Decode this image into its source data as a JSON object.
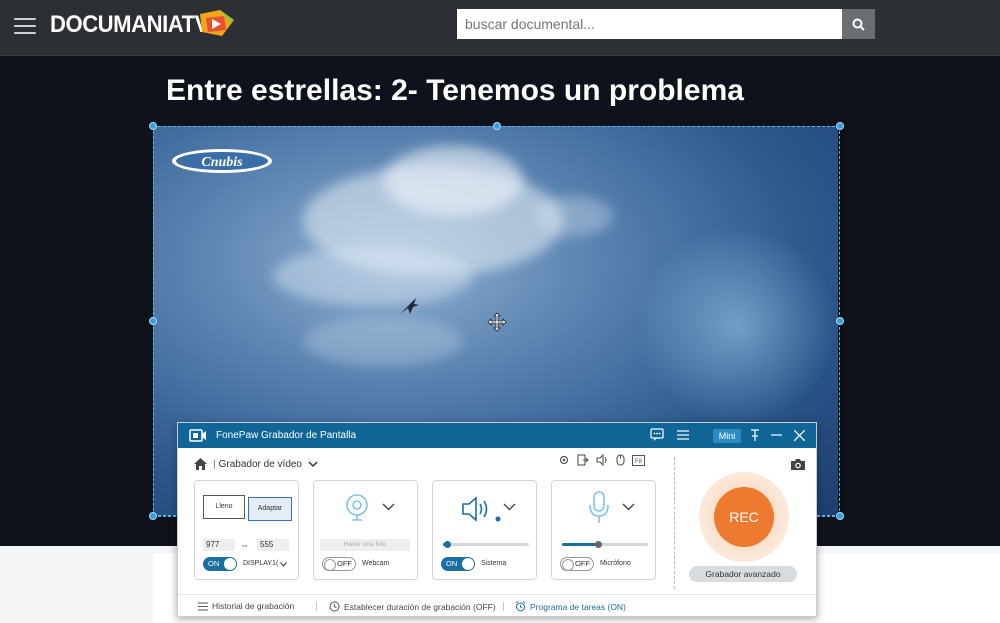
{
  "site": {
    "logo_text": "DOCUMANIATV",
    "search_placeholder": "buscar documental..."
  },
  "page": {
    "title": "Entre estrellas: 2- Tenemos un problema"
  },
  "video": {
    "channel_logo_text": "Cnubis"
  },
  "recorder": {
    "title": "FonePaw Grabador de Pantalla",
    "mini_label": "Mini",
    "mode_separator": "|",
    "mode_label": "Grabador de vídeo",
    "display": {
      "lleno_label": "Lleno",
      "adaptar_label": "Adaptar",
      "width": "977",
      "height": "555",
      "toggle": "ON",
      "source_label": "DISPLAY1("
    },
    "webcam": {
      "photo_label": "Hacer una foto",
      "toggle": "OFF",
      "label": "Webcam"
    },
    "system": {
      "toggle": "ON",
      "label": "Sistema",
      "volume": 0.05
    },
    "microphone": {
      "toggle": "OFF",
      "label": "Micrófono",
      "volume": 0.42
    },
    "rec_label": "REC",
    "advanced_label": "Grabador avanzado",
    "footer": {
      "history": "Historial de grabación",
      "duration": "Establecer duración de grabación (OFF)",
      "schedule": "Programa de tareas (ON)"
    },
    "accent_color": "#0f6696",
    "rec_color": "#ee7a32"
  }
}
